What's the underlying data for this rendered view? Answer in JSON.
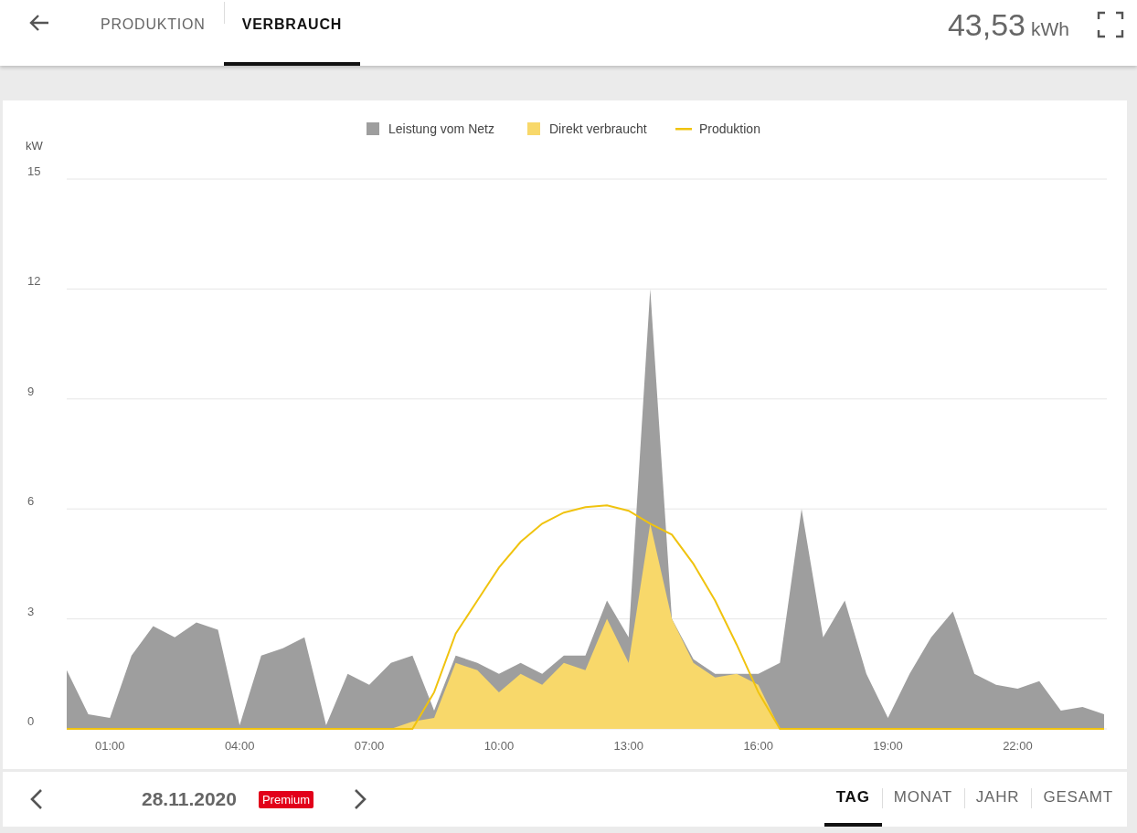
{
  "header": {
    "tabs": [
      {
        "label": "PRODUKTION",
        "selected": false
      },
      {
        "label": "VERBRAUCH",
        "selected": true
      }
    ],
    "total": {
      "value": "43,53",
      "unit": "kWh"
    }
  },
  "chart": {
    "chart_data": {
      "type": "area",
      "ylabel": "kW",
      "grid": true,
      "legend": true,
      "xlim": [
        0,
        24
      ],
      "ylim": [
        0,
        15
      ],
      "x": [
        0,
        0.5,
        1,
        1.5,
        2,
        2.5,
        3,
        3.5,
        4,
        4.5,
        5,
        5.5,
        6,
        6.5,
        7,
        7.5,
        8,
        8.5,
        9,
        9.5,
        10,
        10.5,
        11,
        11.5,
        12,
        12.5,
        13,
        13.5,
        14,
        14.5,
        15,
        15.5,
        16,
        16.5,
        17,
        17.5,
        18,
        18.5,
        19,
        19.5,
        20,
        20.5,
        21,
        21.5,
        22,
        22.5,
        23,
        23.5,
        24
      ],
      "series": [
        {
          "name": "Leistung vom Netz",
          "type": "area",
          "color": "#9e9e9e",
          "values": [
            1.6,
            0.4,
            0.3,
            2.0,
            2.8,
            2.5,
            2.9,
            2.7,
            0.1,
            2.0,
            2.2,
            2.5,
            0.1,
            1.5,
            1.2,
            1.8,
            2.0,
            0.5,
            2.0,
            1.8,
            1.5,
            1.8,
            1.5,
            2.0,
            2.0,
            3.5,
            2.5,
            12.0,
            3.0,
            1.9,
            1.5,
            1.5,
            1.5,
            1.8,
            6.0,
            2.5,
            3.5,
            1.5,
            0.3,
            1.5,
            2.5,
            3.2,
            1.5,
            1.2,
            1.1,
            1.3,
            0.5,
            0.6,
            0.4
          ]
        },
        {
          "name": "Direkt verbraucht",
          "type": "area",
          "color": "#f8d86a",
          "values": [
            0,
            0,
            0,
            0,
            0,
            0,
            0,
            0,
            0,
            0,
            0,
            0,
            0,
            0,
            0,
            0,
            0.2,
            0.3,
            1.8,
            1.6,
            1.0,
            1.5,
            1.2,
            1.8,
            1.6,
            3.0,
            1.8,
            5.6,
            3.0,
            1.8,
            1.4,
            1.5,
            1.2,
            0,
            0,
            0,
            0,
            0,
            0,
            0,
            0,
            0,
            0,
            0,
            0,
            0,
            0,
            0,
            0
          ]
        },
        {
          "name": "Produktion",
          "type": "line",
          "color": "#f0c30f",
          "values": [
            0,
            0,
            0,
            0,
            0,
            0,
            0,
            0,
            0,
            0,
            0,
            0,
            0,
            0,
            0,
            0,
            0,
            1.0,
            2.6,
            3.5,
            4.4,
            5.1,
            5.6,
            5.9,
            6.05,
            6.1,
            5.95,
            5.6,
            5.3,
            4.5,
            3.5,
            2.3,
            1.0,
            0,
            0,
            0,
            0,
            0,
            0,
            0,
            0,
            0,
            0,
            0,
            0,
            0,
            0,
            0,
            0
          ]
        }
      ],
      "xticks": [
        {
          "value": 1,
          "label": "01:00"
        },
        {
          "value": 4,
          "label": "04:00"
        },
        {
          "value": 7,
          "label": "07:00"
        },
        {
          "value": 10,
          "label": "10:00"
        },
        {
          "value": 13,
          "label": "13:00"
        },
        {
          "value": 16,
          "label": "16:00"
        },
        {
          "value": 19,
          "label": "19:00"
        },
        {
          "value": 22,
          "label": "22:00"
        }
      ],
      "yticks": [
        0,
        3,
        6,
        9,
        12,
        15
      ]
    }
  },
  "footer": {
    "date": "28.11.2020",
    "badge": "Premium",
    "periods": [
      {
        "label": "TAG",
        "selected": true
      },
      {
        "label": "MONAT",
        "selected": false
      },
      {
        "label": "JAHR",
        "selected": false
      },
      {
        "label": "GESAMT",
        "selected": false
      }
    ]
  }
}
